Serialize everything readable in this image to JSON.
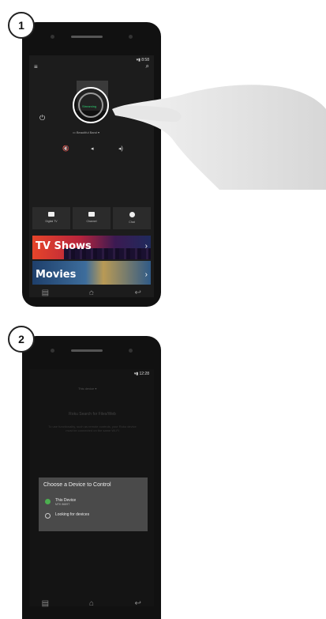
{
  "steps": {
    "one": "1",
    "two": "2"
  },
  "phone1": {
    "status": "8:58",
    "device_label": "Beautiful Band",
    "remote_title": "Streaming",
    "tiles": [
      "Digital TV",
      "Channel",
      "Chat"
    ],
    "banners": [
      "TV Shows",
      "Movies"
    ]
  },
  "phone2": {
    "status": "12:28",
    "header": "This device",
    "bg_heading": "Roku Search for Files/Web",
    "bg_text": "To use functionality, such as remote controls, your Roku device must be connected on the same Wi-Fi",
    "dialog_title": "Choose a Device to Control",
    "option1_label": "This Device",
    "option1_sub": "MTK 8689T",
    "option2_label": "Looking for devices"
  }
}
